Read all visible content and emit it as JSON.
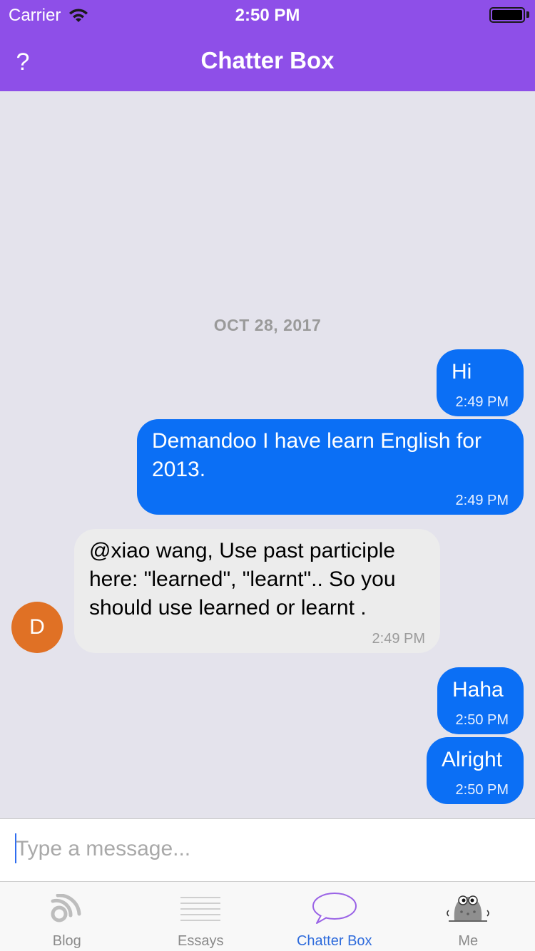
{
  "status_bar": {
    "carrier": "Carrier",
    "time": "2:50 PM"
  },
  "nav": {
    "help_label": "?",
    "title": "Chatter Box"
  },
  "chat": {
    "date": "OCT 28, 2017",
    "messages": [
      {
        "direction": "outgoing",
        "text": "Hi",
        "time": "2:49 PM"
      },
      {
        "direction": "outgoing",
        "text": "Demandoo I have learn English for 2013.",
        "time": "2:49 PM"
      },
      {
        "direction": "incoming",
        "sender_initial": "D",
        "text": "@xiao wang, Use past participle here: \"learned\", \"learnt\".. So you should use learned or learnt .",
        "time": "2:49 PM"
      },
      {
        "direction": "outgoing",
        "text": "Haha",
        "time": "2:50 PM"
      },
      {
        "direction": "outgoing",
        "text": "Alright",
        "time": "2:50 PM"
      }
    ]
  },
  "composer": {
    "placeholder": "Type a message...",
    "value": ""
  },
  "tabbar": {
    "tabs": [
      {
        "label": "Blog",
        "icon": "rss-icon",
        "active": false
      },
      {
        "label": "Essays",
        "icon": "lines-icon",
        "active": false
      },
      {
        "label": "Chatter Box",
        "icon": "speech-bubble-icon",
        "active": true
      },
      {
        "label": "Me",
        "icon": "mascot-icon",
        "active": false
      }
    ]
  },
  "colors": {
    "header": "#8e4fe8",
    "outgoing_bubble": "#0b6ff5",
    "incoming_bubble": "#ececec",
    "avatar": "#e07125",
    "active_tab": "#2f6cdc",
    "background": "#e4e3ec"
  }
}
